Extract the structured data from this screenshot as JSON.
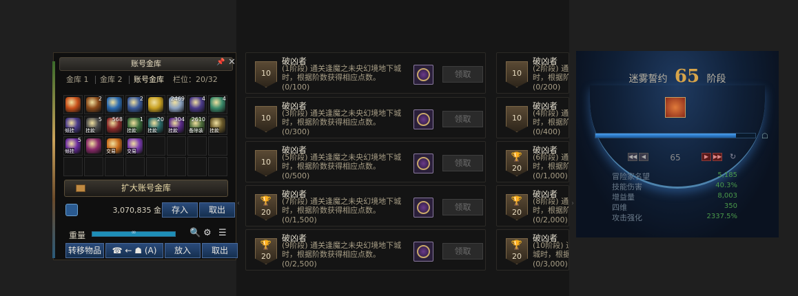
{
  "vault": {
    "title": "账号金库",
    "pin_icon": "pin-icon",
    "close_icon": "close-icon",
    "tabs": [
      "金库 1",
      "金库 2",
      "账号金库"
    ],
    "slots": "栏位：20/32",
    "items": [
      {
        "color": "#c8501a",
        "count": "",
        "tag": ""
      },
      {
        "color": "#8a4a1a",
        "count": "2",
        "tag": ""
      },
      {
        "color": "#2a6ab0",
        "count": "",
        "tag": ""
      },
      {
        "color": "#3a5a9a",
        "count": "2",
        "tag": ""
      },
      {
        "color": "#c8a020",
        "count": "",
        "tag": ""
      },
      {
        "color": "#8aa0c0",
        "count": "2469",
        "tag": ""
      },
      {
        "color": "#4a3a8a",
        "count": "4",
        "tag": ""
      },
      {
        "color": "#3a8a6a",
        "count": "4",
        "tag": ""
      },
      {
        "color": "#4a3a8a",
        "count": "",
        "tag": "倾挂"
      },
      {
        "color": "#4a4a4a",
        "count": "5",
        "tag": "挂款"
      },
      {
        "color": "#8a2a2a",
        "count": "568",
        "tag": ""
      },
      {
        "color": "#3a6a3a",
        "count": "1",
        "tag": "挂款"
      },
      {
        "color": "#2a6a6a",
        "count": "20",
        "tag": "挂款"
      },
      {
        "color": "#5a2a8a",
        "count": "304",
        "tag": "挂款"
      },
      {
        "color": "#4a6a3a",
        "count": "2610",
        "tag": "备除装"
      },
      {
        "color": "#6a5a2a",
        "count": "",
        "tag": "挂款"
      },
      {
        "color": "#6a2aa0",
        "count": "5",
        "tag": "倾挂"
      },
      {
        "color": "#8a2a6a",
        "count": "",
        "tag": ""
      },
      {
        "color": "#c86a1a",
        "count": "",
        "tag": "交易"
      },
      {
        "color": "#7a3ab0",
        "count": "",
        "tag": "交易"
      },
      {
        "color": "",
        "count": "",
        "tag": ""
      },
      {
        "color": "",
        "count": "",
        "tag": ""
      },
      {
        "color": "",
        "count": "",
        "tag": ""
      },
      {
        "color": "",
        "count": "",
        "tag": ""
      },
      {
        "color": "",
        "count": "",
        "tag": ""
      },
      {
        "color": "",
        "count": "",
        "tag": ""
      },
      {
        "color": "",
        "count": "",
        "tag": ""
      },
      {
        "color": "",
        "count": "",
        "tag": ""
      },
      {
        "color": "",
        "count": "",
        "tag": ""
      },
      {
        "color": "",
        "count": "",
        "tag": ""
      },
      {
        "color": "",
        "count": "",
        "tag": ""
      },
      {
        "color": "",
        "count": "",
        "tag": ""
      }
    ],
    "expand_label": "扩大账号金库",
    "gold_amount": "3,070,835",
    "gold_unit": "金币",
    "deposit_label": "存入",
    "withdraw_label": "取出",
    "weight_label": "重量",
    "weight_value": "∞",
    "weight_fill": 1.0,
    "transfer_label": "转移物品",
    "transfer_hint": "(A)",
    "put_label": "放入",
    "take_label": "取出"
  },
  "achievements": {
    "name": "破凶者",
    "desc_suffix": "通关逢魔之未央幻境地下城时，根据阶数获得相应点数。",
    "claim_label": "领取",
    "left": [
      {
        "badge": "10",
        "trophy": false,
        "stage": "(1阶段)",
        "progress": "(0/100)"
      },
      {
        "badge": "10",
        "trophy": false,
        "stage": "(3阶段)",
        "progress": "(0/300)"
      },
      {
        "badge": "10",
        "trophy": false,
        "stage": "(5阶段)",
        "progress": "(0/500)"
      },
      {
        "badge": "20",
        "trophy": true,
        "stage": "(7阶段)",
        "progress": "(0/1,500)"
      },
      {
        "badge": "20",
        "trophy": true,
        "stage": "(9阶段)",
        "progress": "(0/2,500)"
      }
    ],
    "right": [
      {
        "badge": "10",
        "trophy": false,
        "stage": "(2阶段)",
        "progress": "(0/200)"
      },
      {
        "badge": "10",
        "trophy": false,
        "stage": "(4阶段)",
        "progress": "(0/400)"
      },
      {
        "badge": "20",
        "trophy": true,
        "stage": "(6阶段)",
        "progress": "(0/1,000)"
      },
      {
        "badge": "20",
        "trophy": true,
        "stage": "(8阶段)",
        "progress": "(0/2,000)"
      },
      {
        "badge": "20",
        "trophy": true,
        "stage": "(10阶段)",
        "progress": "(0/3,000)"
      }
    ]
  },
  "contract": {
    "title_pre": "迷雾誓约",
    "level": "65",
    "title_post": "阶段",
    "progress_fill": 0.88,
    "stage_value": "65",
    "stats": [
      {
        "label": "冒险家名望",
        "value": "5,185"
      },
      {
        "label": "技能伤害",
        "value": "40.3%"
      },
      {
        "label": "增益量",
        "value": "8,003"
      },
      {
        "label": "四维",
        "value": "350"
      },
      {
        "label": "攻击强化",
        "value": "2337.5%"
      }
    ]
  }
}
